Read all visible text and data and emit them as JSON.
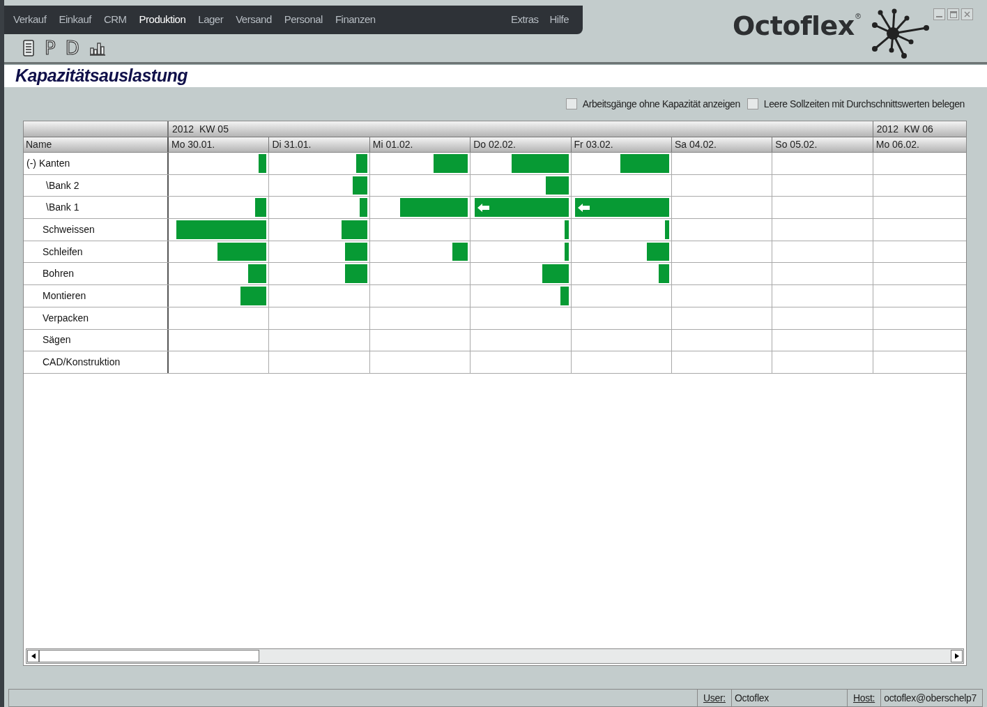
{
  "menu": [
    {
      "label": "Verkauf",
      "selected": false
    },
    {
      "label": "Einkauf",
      "selected": false
    },
    {
      "label": "CRM",
      "selected": false
    },
    {
      "label": "Produktion",
      "selected": true
    },
    {
      "label": "Lager",
      "selected": false
    },
    {
      "label": "Versand",
      "selected": false
    },
    {
      "label": "Personal",
      "selected": false
    },
    {
      "label": "Finanzen",
      "selected": false
    }
  ],
  "menu_right": [
    "Extras",
    "Hilfe"
  ],
  "toolbar": [
    {
      "kind": "document"
    },
    {
      "kind": "letter",
      "label": "P"
    },
    {
      "kind": "letter",
      "label": "D"
    },
    {
      "kind": "chart"
    }
  ],
  "logo": {
    "name": "Octoflex",
    "mark": "®"
  },
  "title": "Kapazitätsauslastung",
  "options": [
    {
      "label": "Arbeitsgänge ohne Kapazität anzeigen",
      "checked": false
    },
    {
      "label": "Leere Sollzeiten mit Durchschnittswerten belegen",
      "checked": false
    }
  ],
  "grid": {
    "weeks": [
      "2012  KW 05",
      "2012  KW 06"
    ],
    "name_column": "Name",
    "days": [
      "Mo 30.01.",
      "Di 31.01.",
      "Mi 01.02.",
      "Do 02.02.",
      "Fr 03.02.",
      "Sa 04.02.",
      "So 05.02.",
      "Mo 06.02."
    ],
    "rows": [
      {
        "name": "(-) Kanten",
        "kind": "group",
        "cells": [
          {
            "level": 0.08
          },
          {
            "level": 0.11
          },
          {
            "level": 0.35
          },
          {
            "level": 0.58
          },
          {
            "level": 0.5
          },
          null,
          null,
          null
        ],
        "children": [
          {
            "name": "\\Bank 2",
            "kind": "machine",
            "cells": [
              null,
              {
                "level": 0.15
              },
              null,
              {
                "level": 0.23
              },
              null,
              null,
              null,
              null
            ]
          },
          {
            "name": "\\Bank 1",
            "kind": "machine",
            "cells": [
              {
                "level": 0.12
              },
              {
                "level": 0.08
              },
              {
                "level": 0.69
              },
              {
                "level": 0.96,
                "arrow": true
              },
              {
                "level": 0.96,
                "arrow": true
              },
              null,
              null,
              null
            ]
          }
        ]
      },
      {
        "name": "Schweissen",
        "kind": "resource",
        "cells": [
          {
            "level": 0.92
          },
          {
            "level": 0.26
          },
          null,
          {
            "level": 0.04
          },
          {
            "level": 0.04
          },
          null,
          null,
          null
        ]
      },
      {
        "name": "Schleifen",
        "kind": "resource",
        "cells": [
          {
            "level": 0.5
          },
          {
            "level": 0.23
          },
          {
            "level": 0.16
          },
          {
            "level": 0.04
          },
          {
            "level": 0.23
          },
          null,
          null,
          null
        ]
      },
      {
        "name": "Bohren",
        "kind": "resource",
        "cells": [
          {
            "level": 0.19
          },
          {
            "level": 0.23
          },
          null,
          {
            "level": 0.27
          },
          {
            "level": 0.11
          },
          null,
          null,
          null
        ]
      },
      {
        "name": "Montieren",
        "kind": "resource",
        "cells": [
          {
            "level": 0.27
          },
          null,
          null,
          {
            "level": 0.08
          },
          null,
          null,
          null,
          null
        ]
      },
      {
        "name": "Verpacken",
        "kind": "resource",
        "cells": [
          null,
          null,
          null,
          null,
          null,
          null,
          null,
          null
        ]
      },
      {
        "name": "Sägen",
        "kind": "resource",
        "cells": [
          null,
          null,
          null,
          null,
          null,
          null,
          null,
          null
        ]
      },
      {
        "name": "CAD/Konstruktion",
        "kind": "resource",
        "cells": [
          null,
          null,
          null,
          null,
          null,
          null,
          null,
          null
        ]
      }
    ]
  },
  "status_bar": [
    {
      "label": "User:",
      "value": "Octoflex"
    },
    {
      "label": "Host:",
      "value": "octoflex@oberschelp7"
    }
  ]
}
